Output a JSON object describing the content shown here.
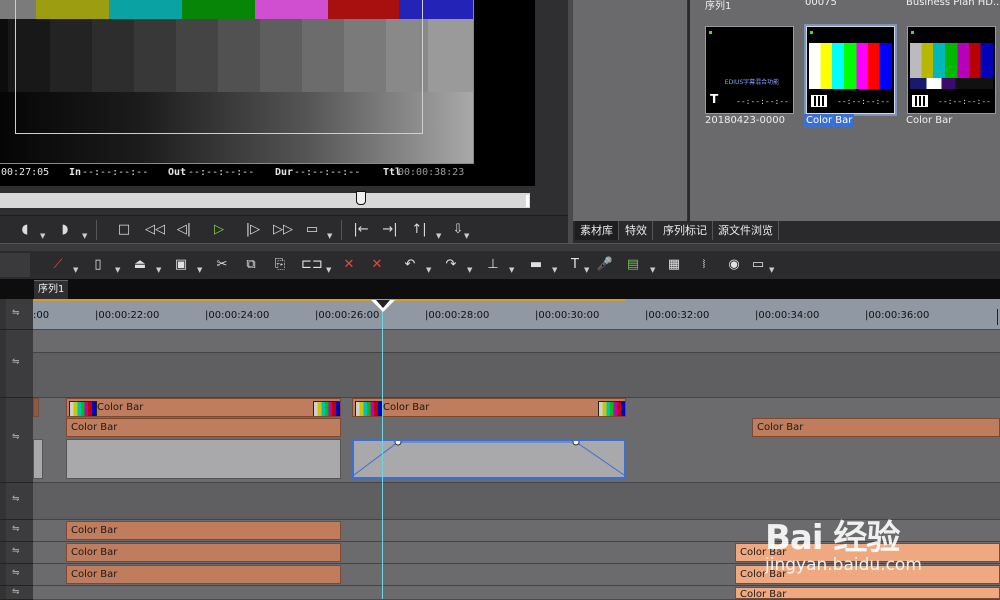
{
  "player": {
    "timecodes": [
      {
        "label": "",
        "value": "00:27:05"
      },
      {
        "label": "In",
        "value": "--:--:--:--"
      },
      {
        "label": "Out",
        "value": "--:--:--:--"
      },
      {
        "label": "Dur",
        "value": "--:--:--:--"
      },
      {
        "label": "Ttl",
        "value": "00:00:38:23"
      }
    ],
    "progress": 0.68
  },
  "bin": {
    "items": [
      {
        "caption": "序列1",
        "label": "20180423-0000",
        "thumb_text": "EDIUS字幕混合功能",
        "selected": false
      },
      {
        "caption": "00075",
        "label": "Color Bar",
        "selected": true
      },
      {
        "caption": "Business Plan HD...",
        "label": "Color Bar",
        "selected": false
      }
    ],
    "thumb_tc": "--:--:--:--",
    "tabs": [
      "素材库",
      "特效",
      "序列标记",
      "源文件浏览"
    ],
    "active_tab": 0
  },
  "sequence": {
    "tab": "序列1"
  },
  "ruler": {
    "labels": [
      ":00",
      "|00:00:22:00",
      "|00:00:24:00",
      "|00:00:26:00",
      "|00:00:28:00",
      "|00:00:30:00",
      "|00:00:32:00",
      "|00:00:34:00",
      "|00:00:36:00"
    ]
  },
  "clips": {
    "label": "Color Bar"
  },
  "watermark": {
    "logo": "Bai 经验",
    "url": "jingyan.baidu.com"
  },
  "colors": {
    "clip": "#bf7d5d",
    "selection": "#3a6fd6",
    "playhead": "#6fd3e0",
    "ruler_progress": "#d99a2a"
  }
}
